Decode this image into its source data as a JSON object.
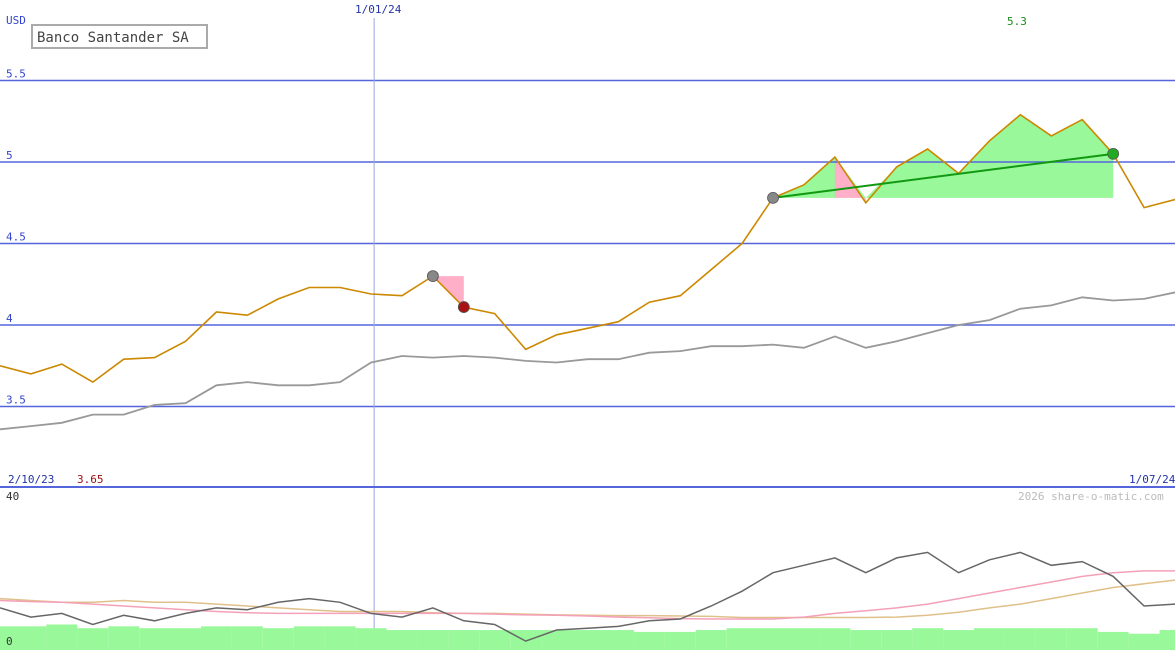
{
  "chart_data": [
    {
      "type": "line",
      "title": "Banco Santander SA",
      "currency": "USD",
      "date_start": "2/10/23",
      "date_marker": "1/01/24",
      "date_end": "1/07/24",
      "high_label": "5.3",
      "low_label": "3.65",
      "y_ticks": [
        "3.5",
        "4",
        "4.5",
        "5",
        "5.5"
      ],
      "ylim": [
        3.35,
        5.9
      ],
      "grid": true,
      "colors": {
        "price": "#cc8800",
        "average": "#999999",
        "trend": "#119911",
        "gain_fill": "#99f899",
        "loss_fill": "#ffb0c8",
        "grid": "#5566dd"
      },
      "series": [
        {
          "role": "price",
          "values": [
            3.75,
            3.7,
            3.76,
            3.65,
            3.79,
            3.8,
            3.9,
            4.08,
            4.06,
            4.16,
            4.23,
            4.23,
            4.19,
            4.18,
            4.3,
            4.11,
            4.07,
            3.85,
            3.94,
            3.98,
            4.02,
            4.14,
            4.18,
            4.34,
            4.5,
            4.78,
            4.86,
            5.03,
            4.75,
            4.97,
            5.08,
            4.93,
            5.13,
            5.29,
            5.16,
            5.26,
            5.05,
            4.72,
            4.77
          ]
        },
        {
          "role": "average",
          "values": [
            3.36,
            3.38,
            3.4,
            3.45,
            3.45,
            3.51,
            3.52,
            3.63,
            3.65,
            3.63,
            3.63,
            3.65,
            3.77,
            3.81,
            3.8,
            3.81,
            3.8,
            3.78,
            3.77,
            3.79,
            3.79,
            3.83,
            3.84,
            3.87,
            3.87,
            3.88,
            3.86,
            3.93,
            3.86,
            3.9,
            3.95,
            4.0,
            4.03,
            4.1,
            4.12,
            4.17,
            4.15,
            4.16,
            4.2
          ]
        }
      ],
      "annotations": [
        {
          "type": "trend",
          "from_index": 25,
          "to_index": 36,
          "from_value": 4.78,
          "to_value": 5.05
        },
        {
          "type": "loss",
          "from_index": 14,
          "to_index": 15,
          "from_value": 4.3,
          "to_value": 4.11
        }
      ]
    },
    {
      "type": "line",
      "role": "indicator",
      "y_ticks": [
        "0",
        "40"
      ],
      "ylim": [
        0,
        40
      ],
      "watermark": "2026 share-o-matic.com",
      "colors": {
        "main": "#666666",
        "pink": "#f4a0b8",
        "tan": "#e0c08a",
        "volume": "#99f899"
      },
      "series": [
        {
          "role": "main",
          "values": [
            9.5,
            7,
            8,
            5,
            7.5,
            6,
            8,
            9.5,
            9,
            11,
            12,
            11,
            8,
            7,
            9.5,
            6,
            5,
            0.5,
            3.5,
            4,
            4.5,
            6,
            6.5,
            10,
            14,
            19,
            21,
            23,
            19,
            23,
            24.5,
            19,
            22.5,
            24.5,
            21,
            22,
            18,
            10,
            10.5
          ]
        },
        {
          "role": "pink",
          "values": [
            11.5,
            11.2,
            11,
            10.5,
            10,
            9.5,
            9,
            8.5,
            8.2,
            8,
            8,
            8,
            8,
            8,
            8,
            8,
            7.8,
            7.6,
            7.5,
            7.3,
            7,
            6.8,
            6.6,
            6.5,
            6.5,
            6.5,
            7,
            8,
            8.7,
            9.5,
            10.5,
            12,
            13.5,
            15,
            16.5,
            18,
            19,
            19.5,
            19.5
          ]
        },
        {
          "role": "tan",
          "values": [
            12,
            11.5,
            11,
            11,
            11.5,
            11,
            11,
            10.5,
            10,
            9.5,
            9,
            8.5,
            8.5,
            8.5,
            8.2,
            8,
            8,
            7.8,
            7.6,
            7.5,
            7.4,
            7.4,
            7.3,
            7.2,
            6.9,
            6.9,
            6.9,
            6.9,
            6.9,
            7,
            7.5,
            8.3,
            9.5,
            10.5,
            12,
            13.5,
            15,
            16,
            17
          ]
        },
        {
          "role": "volume",
          "values": [
            4.5,
            4.5,
            5,
            4,
            4.5,
            4,
            4,
            4.5,
            4.5,
            4,
            4.5,
            4.5,
            4,
            3.5,
            3.5,
            3.5,
            3.5,
            3.5,
            3.5,
            3.5,
            3.5,
            3,
            3,
            3.5,
            4,
            4,
            4,
            4,
            3.5,
            3.5,
            4,
            3.5,
            4,
            4,
            4,
            4,
            3,
            2.5,
            3.5
          ]
        }
      ]
    }
  ]
}
